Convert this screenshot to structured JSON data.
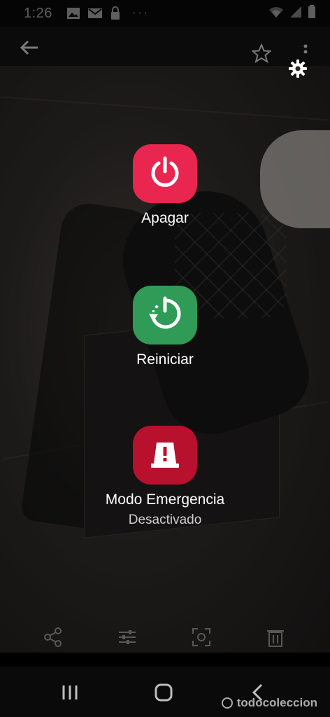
{
  "status_bar": {
    "time": "1:26",
    "icons": [
      "image-icon",
      "mail-icon",
      "lock-icon",
      "more-dots-icon",
      "wifi-icon",
      "signal-icon",
      "battery-icon"
    ],
    "dots": "···"
  },
  "toolbar": {
    "icons": [
      "back-arrow-icon",
      "star-icon",
      "more-vert-icon"
    ]
  },
  "power_menu": {
    "items": [
      {
        "label": "Apagar",
        "icon": "power-icon",
        "color": "#e8264f"
      },
      {
        "label": "Reiniciar",
        "icon": "restart-icon",
        "color": "#2f9b57"
      },
      {
        "label": "Modo Emergencia",
        "sublabel": "Desactivado",
        "icon": "emergency-icon",
        "color": "#b7112e"
      }
    ]
  },
  "settings": {
    "icon": "gear-icon"
  },
  "action_bar": {
    "icons": [
      "share-icon",
      "adjust-icon",
      "focus-icon",
      "trash-icon"
    ]
  },
  "nav_bar": {
    "icons": [
      "recents-icon",
      "home-icon",
      "back-icon"
    ]
  },
  "watermark": {
    "text": "todocoleccion"
  }
}
